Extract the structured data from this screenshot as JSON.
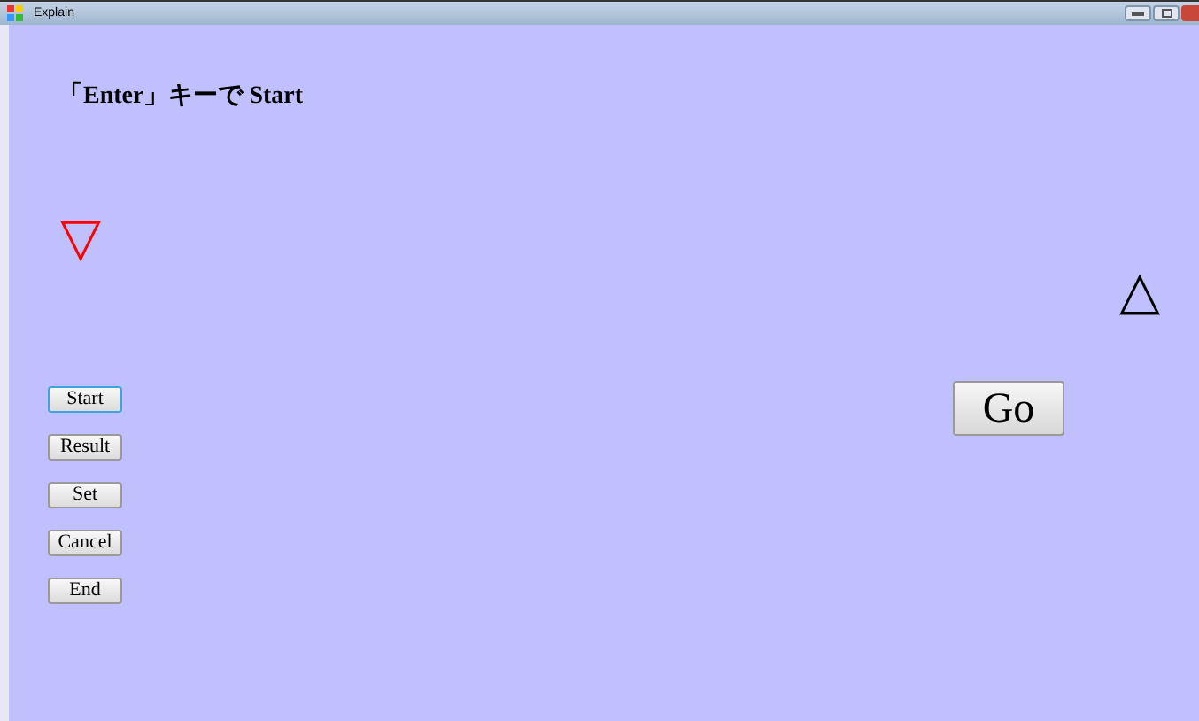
{
  "window": {
    "title": "Explain"
  },
  "instruction": "「Enter」キーで Start",
  "markers": [
    {
      "symbol": "▽",
      "color": "#ff0000"
    },
    {
      "symbol": "△",
      "color": "#000000"
    }
  ],
  "buttons": [
    {
      "label": "Start",
      "focused": true
    },
    {
      "label": "Result",
      "focused": false
    },
    {
      "label": "Set",
      "focused": false
    },
    {
      "label": "Cancel",
      "focused": false
    },
    {
      "label": "End",
      "focused": false
    }
  ],
  "go_button": {
    "label": "Go"
  }
}
